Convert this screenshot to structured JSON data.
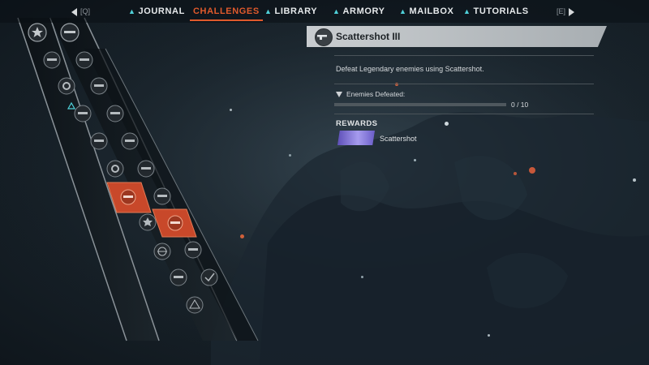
{
  "nav": {
    "prev_key": "[Q]",
    "next_key": "[E]",
    "tabs": [
      {
        "label": "JOURNAL",
        "active": false
      },
      {
        "label": "CHALLENGES",
        "active": true
      },
      {
        "label": "LIBRARY",
        "active": false
      },
      {
        "label": "ARMORY",
        "active": false
      },
      {
        "label": "MAILBOX",
        "active": false
      },
      {
        "label": "TUTORIALS",
        "active": false
      }
    ]
  },
  "challenge": {
    "title": "Scattershot III",
    "icon": "shotgun-icon",
    "description": "Defeat Legendary enemies using Scattershot.",
    "objective": {
      "label": "Enemies Defeated:",
      "current": 0,
      "target": 10,
      "progress_text": "0 / 10"
    },
    "rewards_title": "REWARDS",
    "rewards": [
      {
        "name": "Scattershot",
        "icon": "scattershot-weapon-icon"
      }
    ]
  },
  "colors": {
    "accent_orange": "#e05a2c",
    "accent_cyan": "#4fd1d9",
    "panel_header": "#c9cdd0",
    "reward_purple": "#8a7ee0"
  }
}
